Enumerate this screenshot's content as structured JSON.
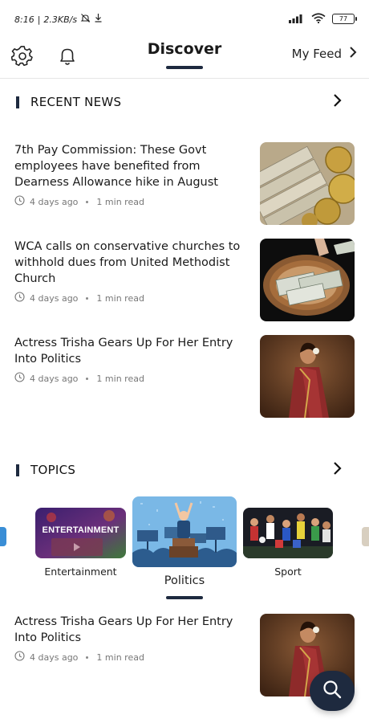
{
  "status_bar": {
    "time": "8:16",
    "speed": "2.3KB/s",
    "battery": "77"
  },
  "header": {
    "title": "Discover",
    "my_feed_label": "My Feed",
    "icons": [
      "gear-icon",
      "bell-icon",
      "chevron-right-icon"
    ]
  },
  "recent_news": {
    "title": "RECENT NEWS",
    "articles": [
      {
        "title": "7th Pay Commission: These Govt employees have benefited from Dearness Allowance hike in August",
        "age": "4 days ago",
        "read_time": "1 min read"
      },
      {
        "title": "WCA calls on conservative churches to withhold dues from United Methodist Church",
        "age": "4 days ago",
        "read_time": "1 min read"
      },
      {
        "title": "Actress Trisha Gears Up For Her Entry Into Politics",
        "age": "4 days ago",
        "read_time": "1 min read"
      }
    ]
  },
  "topics": {
    "title": "TOPICS",
    "items": [
      {
        "label": "Entertainment",
        "banner": "ENTERTAINMENT"
      },
      {
        "label": "Politics"
      },
      {
        "label": "Sport"
      }
    ]
  },
  "topic_feed": {
    "articles": [
      {
        "title": "Actress Trisha Gears Up For Her Entry Into Politics",
        "age": "4 days ago",
        "read_time": "1 min read"
      }
    ]
  },
  "colors": {
    "accent": "#1e2a3f",
    "meta": "#777777"
  }
}
